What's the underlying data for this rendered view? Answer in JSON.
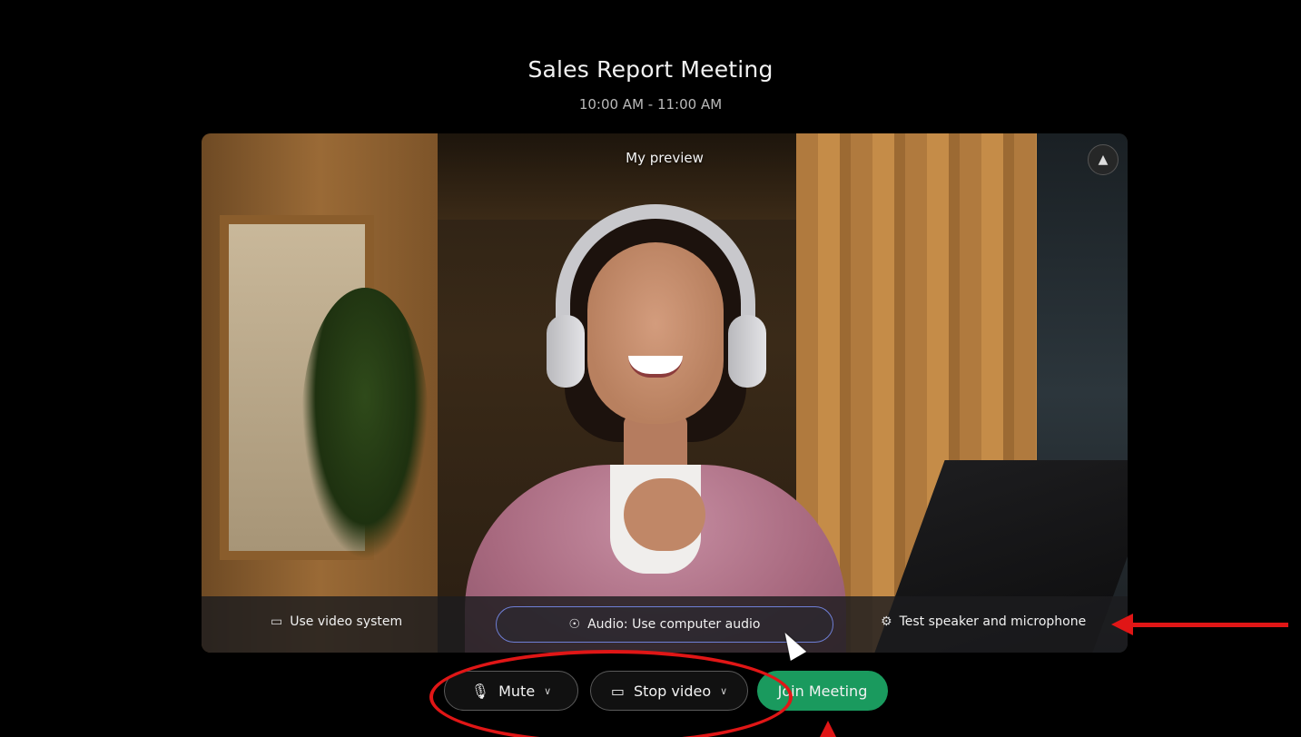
{
  "meeting": {
    "title": "Sales Report Meeting",
    "time": "10:00 AM - 11:00 AM"
  },
  "preview": {
    "label": "My preview",
    "mirror_icon": "mirror-icon"
  },
  "preview_bar": {
    "video_system_label": "Use video system",
    "audio_label": "Audio: Use computer audio",
    "test_label": "Test speaker and microphone",
    "icons": {
      "video_system": "cast-screen-icon",
      "audio": "headset-icon",
      "test": "gear-icon"
    }
  },
  "controls": {
    "mute_label": "Mute",
    "stop_video_label": "Stop video",
    "join_label": "Join Meeting"
  },
  "colors": {
    "join": "#1a9a5e",
    "audio_outline": "#6f7fd6",
    "annotation": "#e01616"
  }
}
